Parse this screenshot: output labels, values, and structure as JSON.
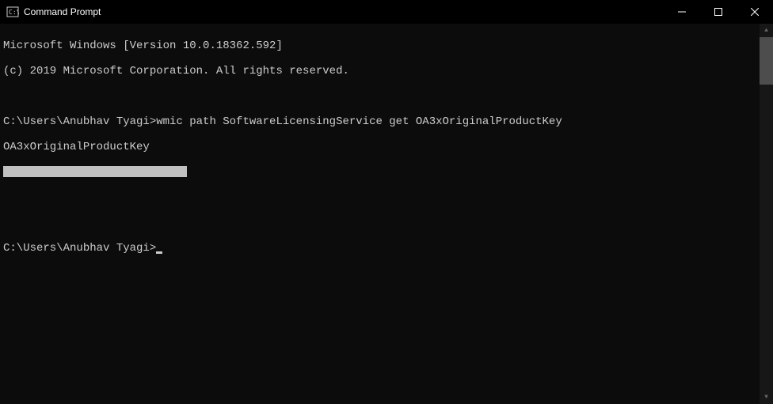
{
  "titlebar": {
    "title": "Command Prompt"
  },
  "terminal": {
    "line1": "Microsoft Windows [Version 10.0.18362.592]",
    "line2": "(c) 2019 Microsoft Corporation. All rights reserved.",
    "prompt1": "C:\\Users\\Anubhav Tyagi>",
    "command1": "wmic path SoftwareLicensingService get OA3xOriginalProductKey",
    "output_header": "OA3xOriginalProductKey",
    "prompt2": "C:\\Users\\Anubhav Tyagi>"
  }
}
